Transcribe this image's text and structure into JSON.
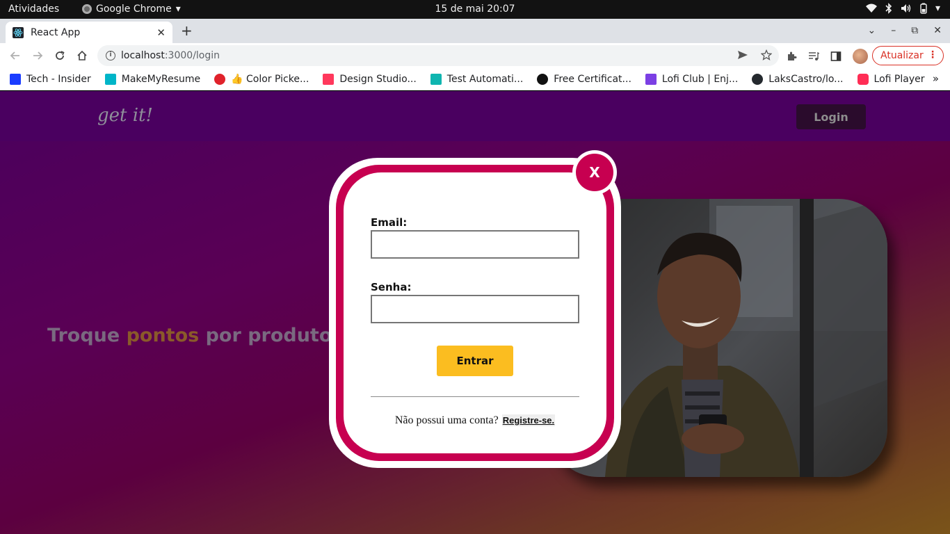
{
  "system_bar": {
    "activities": "Atividades",
    "app_name": "Google Chrome",
    "clock": "15 de mai  20:07"
  },
  "browser": {
    "tab_title": "React App",
    "url_host": "localhost",
    "url_path": ":3000/login",
    "update_label": "Atualizar",
    "bookmarks": [
      {
        "label": "Tech - Insider",
        "color": "#1a3cff"
      },
      {
        "label": "MakeMyResume",
        "color": "#00b5c8"
      },
      {
        "label": "👍 Color Picke...",
        "color": "#e0222b"
      },
      {
        "label": "Design Studio...",
        "color": "#ff385c"
      },
      {
        "label": "Test Automati...",
        "color": "#0fb5b0"
      },
      {
        "label": "Free Certificat...",
        "color": "#111111"
      },
      {
        "label": "Lofi Club | Enj...",
        "color": "#7b3fe4"
      },
      {
        "label": "LaksCastro/lo...",
        "color": "#24292e"
      },
      {
        "label": "Lofi Player",
        "color": "#ff2d55"
      }
    ]
  },
  "page": {
    "logo": "get it!",
    "login_button": "Login",
    "hero_before": "Troque ",
    "hero_accent": "pontos",
    "hero_after": " por produtos e",
    "modal": {
      "close_label": "X",
      "email_label": "Email:",
      "email_value": "",
      "password_label": "Senha:",
      "password_value": "",
      "submit_label": "Entrar",
      "register_prompt": "Não possui uma conta?",
      "register_link": "Registre-se."
    }
  }
}
